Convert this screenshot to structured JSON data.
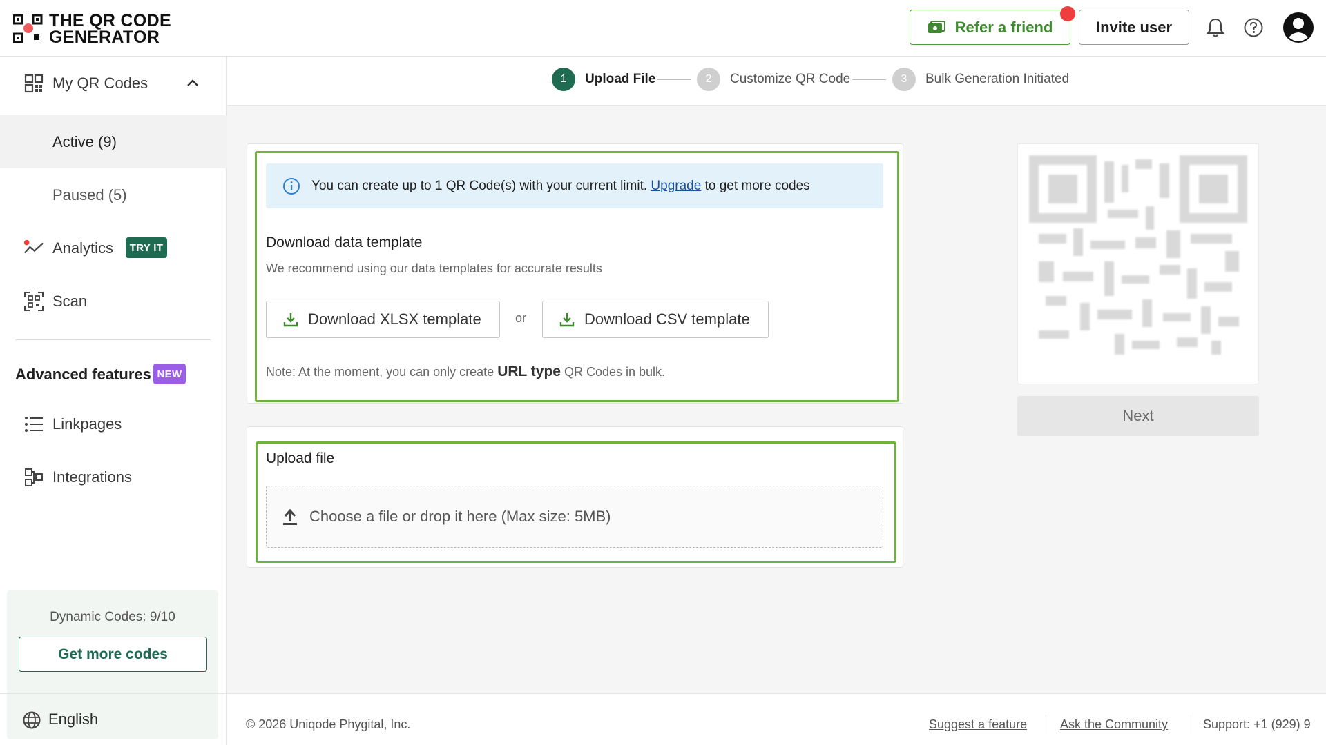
{
  "header": {
    "logo_line1": "THE QR CODE",
    "logo_line2": "GENERATOR",
    "refer_label": "Refer a friend",
    "invite_label": "Invite user"
  },
  "sidebar": {
    "my_qr_codes": "My QR Codes",
    "active": "Active (9)",
    "paused": "Paused (5)",
    "analytics": "Analytics",
    "analytics_badge": "TRY IT",
    "scan": "Scan",
    "advanced_title": "Advanced features",
    "advanced_badge": "NEW",
    "linkpages": "Linkpages",
    "integrations": "Integrations",
    "quota_text": "Dynamic Codes: 9/10",
    "get_more": "Get more codes",
    "language": "English"
  },
  "stepper": {
    "steps": [
      {
        "num": "1",
        "label": "Upload File"
      },
      {
        "num": "2",
        "label": "Customize QR Code"
      },
      {
        "num": "3",
        "label": "Bulk Generation Initiated"
      }
    ]
  },
  "template_card": {
    "banner_pre": "You can create up to 1 QR Code(s) with your current limit. ",
    "banner_link": "Upgrade",
    "banner_post": " to get more codes",
    "title": "Download data template",
    "subtitle": "We recommend using our data templates for accurate results",
    "xlsx_button": "Download XLSX template",
    "or": "or",
    "csv_button": "Download CSV template",
    "note_pre": "Note: At the moment, you can only create ",
    "note_bold": "URL type",
    "note_post": " QR Codes in bulk."
  },
  "upload_card": {
    "title": "Upload file",
    "dropzone": "Choose a file or drop it here (Max size: 5MB)"
  },
  "preview": {
    "next": "Next"
  },
  "footer": {
    "copyright": "© 2026 Uniqode Phygital, Inc.",
    "suggest": "Suggest a feature",
    "community": "Ask the Community",
    "support": "Support:  +1 (929) 9"
  },
  "colors": {
    "brand_green": "#1f6b52",
    "card_border_green": "#6fb33f",
    "info_bg": "#e3f1fb",
    "notification_red": "#ef3e3e",
    "new_badge": "#9b5de5"
  }
}
